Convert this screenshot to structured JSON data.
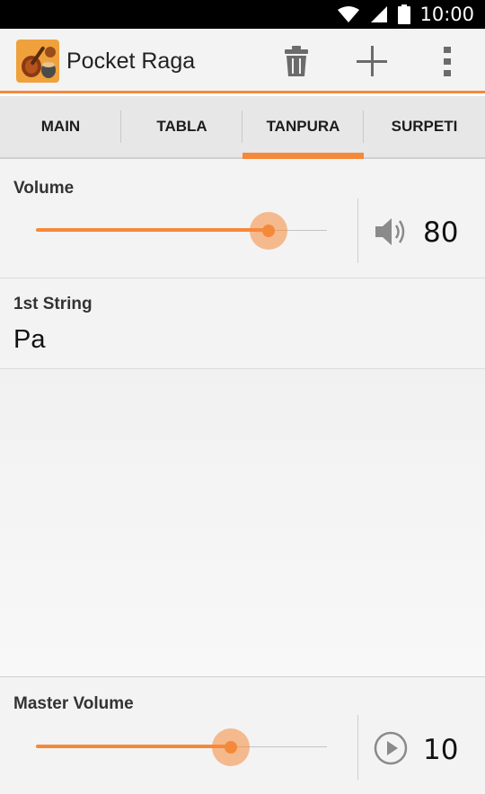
{
  "status": {
    "time": "10:00"
  },
  "app": {
    "title": "Pocket Raga"
  },
  "toolbar": {
    "icons": [
      "trash-icon",
      "plus-icon",
      "overflow-menu-icon"
    ]
  },
  "tabs": [
    {
      "label": "MAIN",
      "active": false
    },
    {
      "label": "TABLA",
      "active": false
    },
    {
      "label": "TANPURA",
      "active": true
    },
    {
      "label": "SURPETI",
      "active": false
    }
  ],
  "volume": {
    "label": "Volume",
    "value": "80",
    "level": 80,
    "icon": "speaker-icon"
  },
  "first_string": {
    "label": "1st String",
    "value": "Pa"
  },
  "master_volume": {
    "label": "Master Volume",
    "value": "10",
    "level": 67,
    "icon": "play-icon"
  },
  "colors": {
    "accent": "#f5893a",
    "background": "#f3f3f3"
  }
}
